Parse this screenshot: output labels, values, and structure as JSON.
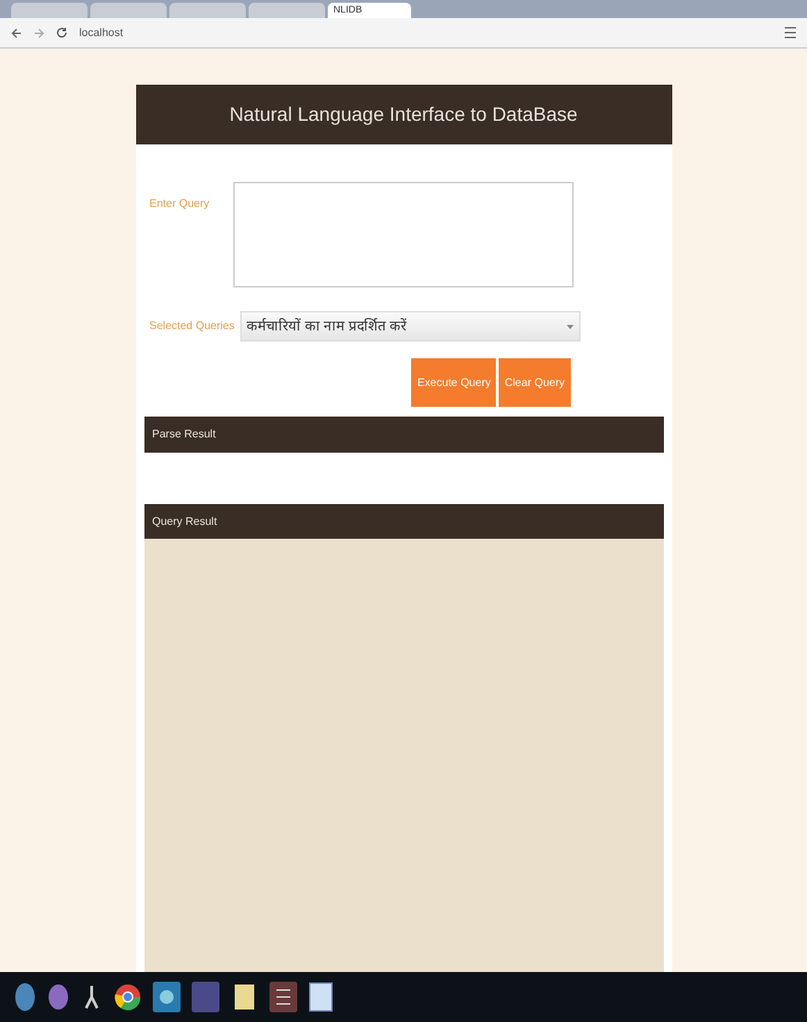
{
  "browser": {
    "tabs": [
      {
        "selected": false
      },
      {
        "selected": false
      },
      {
        "selected": false
      },
      {
        "selected": false
      },
      {
        "label": "NLIDB",
        "selected": true
      }
    ],
    "address": "localhost"
  },
  "page": {
    "title": "Natural Language Interface to DataBase",
    "query_label": "Enter Query",
    "selected_label": "Selected Queries",
    "selected_value": "कर्मचारियों का नाम प्रदर्शित करें",
    "buttons": [
      "Execute Query",
      "Clear Query"
    ],
    "parse_result": "Parse Result",
    "query_result": "Query Result"
  }
}
